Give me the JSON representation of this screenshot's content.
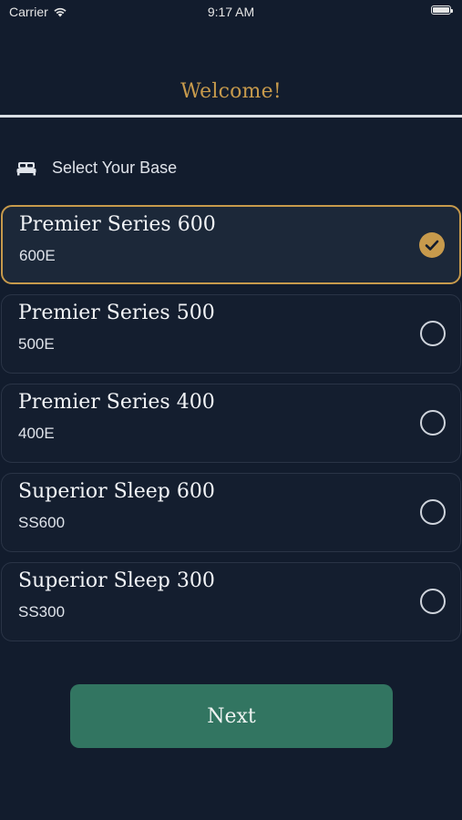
{
  "status_bar": {
    "carrier": "Carrier",
    "time": "9:17 AM",
    "wifi_icon": "wifi-icon",
    "battery_level": 1.0
  },
  "header": {
    "title": "Welcome!"
  },
  "section": {
    "icon": "bed-icon",
    "label": "Select Your Base"
  },
  "options": [
    {
      "name": "Premier Series 600",
      "code": "600E",
      "selected": true
    },
    {
      "name": "Premier Series 500",
      "code": "500E",
      "selected": false
    },
    {
      "name": "Premier Series 400",
      "code": "400E",
      "selected": false
    },
    {
      "name": "Superior Sleep 600",
      "code": "SS600",
      "selected": false
    },
    {
      "name": "Superior Sleep 300",
      "code": "SS300",
      "selected": false
    }
  ],
  "actions": {
    "next_label": "Next"
  },
  "colors": {
    "background": "#121c2d",
    "accent_gold": "#c79a4c",
    "button_green": "#327561",
    "card_border": "#2a3446"
  }
}
